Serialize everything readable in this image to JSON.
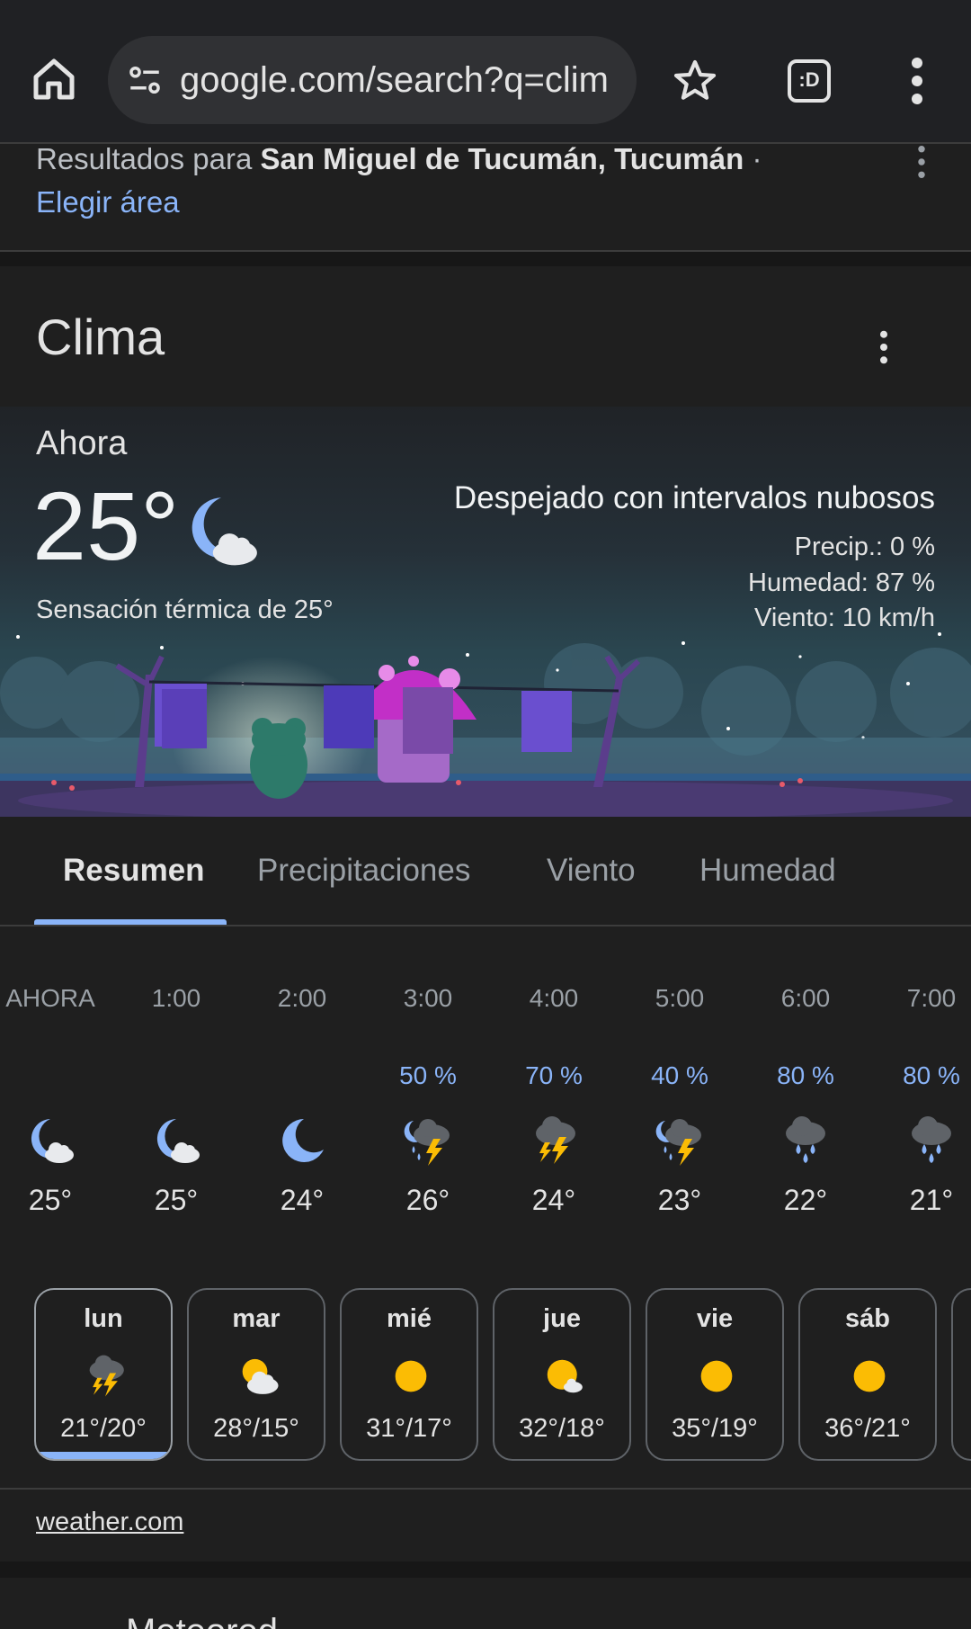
{
  "browser": {
    "url": "google.com/search?q=clim",
    "tabs_label": ":D"
  },
  "results_header": {
    "prefix": "Resultados para ",
    "location": "San Miguel de Tucumán, Tucumán",
    "suffix": " ·",
    "choose_area": "Elegir área"
  },
  "widget": {
    "title": "Clima",
    "now_label": "Ahora",
    "temperature": "25°",
    "now_icon": "moon-cloud-icon",
    "feels_like": "Sensación térmica de 25°",
    "condition": "Despejado con intervalos nubosos",
    "precip": "Precip.: 0 %",
    "humidity": "Humedad: 87 %",
    "wind": "Viento: 10 km/h"
  },
  "tabs": [
    {
      "label": "Resumen",
      "active": true
    },
    {
      "label": "Precipitaciones",
      "active": false
    },
    {
      "label": "Viento",
      "active": false
    },
    {
      "label": "Humedad",
      "active": false
    }
  ],
  "hourly": [
    {
      "time": "AHORA",
      "prob": "",
      "icon": "moon-cloud-icon",
      "temp": "25°"
    },
    {
      "time": "1:00",
      "prob": "",
      "icon": "moon-cloud-icon",
      "temp": "25°"
    },
    {
      "time": "2:00",
      "prob": "",
      "icon": "moon-icon",
      "temp": "24°"
    },
    {
      "time": "3:00",
      "prob": "50 %",
      "icon": "night-thunderstorm-icon",
      "temp": "26°"
    },
    {
      "time": "4:00",
      "prob": "70 %",
      "icon": "thunderstorm-icon",
      "temp": "24°"
    },
    {
      "time": "5:00",
      "prob": "40 %",
      "icon": "night-thunderstorm-icon",
      "temp": "23°"
    },
    {
      "time": "6:00",
      "prob": "80 %",
      "icon": "rain-icon",
      "temp": "22°"
    },
    {
      "time": "7:00",
      "prob": "80 %",
      "icon": "rain-icon",
      "temp": "21°"
    }
  ],
  "daily": [
    {
      "day": "lun",
      "icon": "thunderstorm-icon",
      "temps": "21°/20°",
      "selected": true
    },
    {
      "day": "mar",
      "icon": "partly-cloudy-icon",
      "temps": "28°/15°",
      "selected": false
    },
    {
      "day": "mié",
      "icon": "sun-icon",
      "temps": "31°/17°",
      "selected": false
    },
    {
      "day": "jue",
      "icon": "sun-small-cloud-icon",
      "temps": "32°/18°",
      "selected": false
    },
    {
      "day": "vie",
      "icon": "sun-icon",
      "temps": "35°/19°",
      "selected": false
    },
    {
      "day": "sáb",
      "icon": "sun-icon",
      "temps": "36°/21°",
      "selected": false
    }
  ],
  "source": "weather.com",
  "next_section_title": "Meteored",
  "colors": {
    "accent": "#8ab4f8",
    "background": "#1f1f1f",
    "sun": "#fbbc04",
    "moon": "#8ab4f8"
  }
}
